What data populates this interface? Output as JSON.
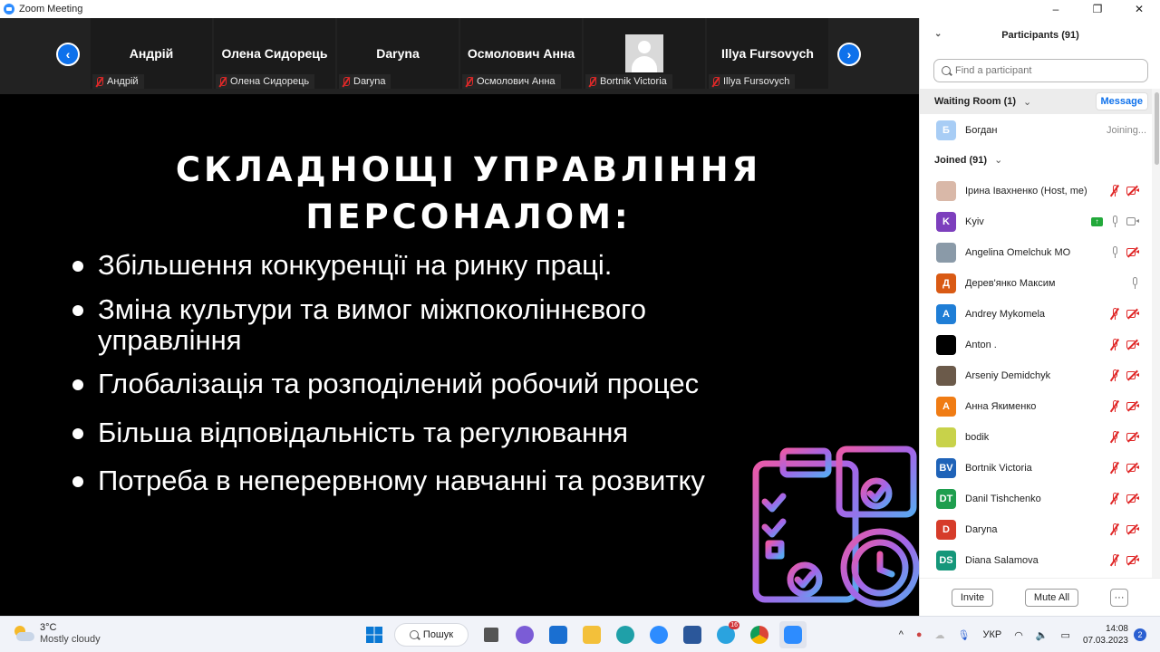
{
  "window": {
    "title": "Zoom Meeting",
    "controls": [
      "–",
      "❐",
      "✕"
    ]
  },
  "gallery": {
    "tiles": [
      {
        "name": "Андрій",
        "label": "Андрій",
        "has_avatar": false
      },
      {
        "name": "Олена Сидорець",
        "label": "Олена Сидорець",
        "has_avatar": false
      },
      {
        "name": "Daryna",
        "label": "Daryna",
        "has_avatar": false
      },
      {
        "name": "Осмолович Анна",
        "label": "Осмолович Анна",
        "has_avatar": false
      },
      {
        "name": "",
        "label": "Bortnik Victoria",
        "has_avatar": true
      },
      {
        "name": "Illya Fursovych",
        "label": "Illya Fursovych",
        "has_avatar": false
      }
    ],
    "prev_icon": "chevron-left-icon",
    "next_icon": "chevron-right-icon"
  },
  "slide": {
    "title_line1": "СКЛАДНОЩІ УПРАВЛІННЯ",
    "title_line2": "ПЕРСОНАЛОМ:",
    "bullets": [
      "Збільшення конкуренції на ринку праці.",
      "Зміна культури та вимог міжпоколіннєвого управління",
      "Глобалізація та розподілений робочий процес",
      "Більша відповідальність та регулювання",
      "Потреба в неперервному навчанні та розвитку"
    ]
  },
  "participants": {
    "header": "Participants (91)",
    "search_placeholder": "Find a participant",
    "waiting_room": "Waiting Room (1)",
    "message_button": "Message",
    "waiting": {
      "name": "Богдан",
      "initial": "Б",
      "status": "Joining...",
      "color": "#a8cdf5"
    },
    "joined_label": "Joined (91)",
    "list": [
      {
        "name": "Ірина Івахненко (Host, me)",
        "initial": "",
        "color": "#d9b8a8",
        "mic": "muted",
        "cam": "off",
        "share": false
      },
      {
        "name": "Kyiv",
        "initial": "K",
        "color": "#7d3fbd",
        "mic": "on",
        "cam": "on",
        "share": true
      },
      {
        "name": "Angelina Omelchuk MO",
        "initial": "",
        "color": "#8a9aa8",
        "mic": "on",
        "cam": "off",
        "share": false
      },
      {
        "name": "Дерев'янко Максим",
        "initial": "Д",
        "color": "#d95a14",
        "mic": "on",
        "cam": "none",
        "share": false
      },
      {
        "name": "Andrey Mykomela",
        "initial": "A",
        "color": "#1f7ed6",
        "mic": "muted",
        "cam": "off",
        "share": false
      },
      {
        "name": "Anton .",
        "initial": "",
        "color": "#000000",
        "mic": "muted",
        "cam": "off",
        "share": false
      },
      {
        "name": "Arseniy Demidchyk",
        "initial": "",
        "color": "#6b5a4a",
        "mic": "muted",
        "cam": "off",
        "share": false
      },
      {
        "name": "Анна Якименко",
        "initial": "A",
        "color": "#f07c14",
        "mic": "muted",
        "cam": "off",
        "share": false
      },
      {
        "name": "bodik",
        "initial": "",
        "color": "#c8d24a",
        "mic": "muted",
        "cam": "off",
        "share": false
      },
      {
        "name": "Bortnik Victoria",
        "initial": "BV",
        "color": "#1f63b8",
        "mic": "muted",
        "cam": "off",
        "share": false
      },
      {
        "name": "Danil Tishchenko",
        "initial": "DT",
        "color": "#1e9e4e",
        "mic": "muted",
        "cam": "off",
        "share": false
      },
      {
        "name": "Daryna",
        "initial": "D",
        "color": "#d63c2a",
        "mic": "muted",
        "cam": "off",
        "share": false
      },
      {
        "name": "Diana Salamova",
        "initial": "DS",
        "color": "#15977a",
        "mic": "muted",
        "cam": "off",
        "share": false
      }
    ],
    "invite_button": "Invite",
    "mute_all_button": "Mute All",
    "more_button": "···"
  },
  "taskbar": {
    "weather_temp": "3°C",
    "weather_desc": "Mostly cloudy",
    "search_label": "Пошук",
    "telegram_badge": "16",
    "language": "УКР",
    "time": "14:08",
    "date": "07.03.2023",
    "notifications": "2"
  }
}
